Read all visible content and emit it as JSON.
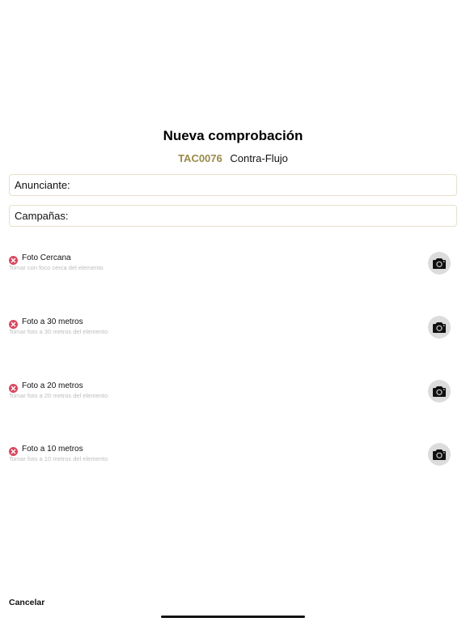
{
  "header": {
    "title": "Nueva comprobación",
    "code": "TAC0076",
    "name": "Contra-Flujo"
  },
  "fields": {
    "advertiser_label": "Anunciante:",
    "campaigns_label": "Campañas:"
  },
  "photos": [
    {
      "label": "Foto Cercana",
      "hint": "Tomar con foco cerca del elemento",
      "status": "error-icon"
    },
    {
      "label": "Foto a 30 metros",
      "hint": "Tomar foto a 30 metros del elemento",
      "status": "error-icon"
    },
    {
      "label": "Foto a 20 metros",
      "hint": "Tomar foto a 20 metros del elemento",
      "status": "error-icon"
    },
    {
      "label": "Foto a 10 metros",
      "hint": "Tomar foto a 10 metros del elemento",
      "status": "error-icon"
    }
  ],
  "footer": {
    "cancel_label": "Cancelar"
  },
  "colors": {
    "code_accent": "#9a8a4a",
    "error": "#d9475e",
    "camera_button_bg": "#dcdcdc"
  }
}
